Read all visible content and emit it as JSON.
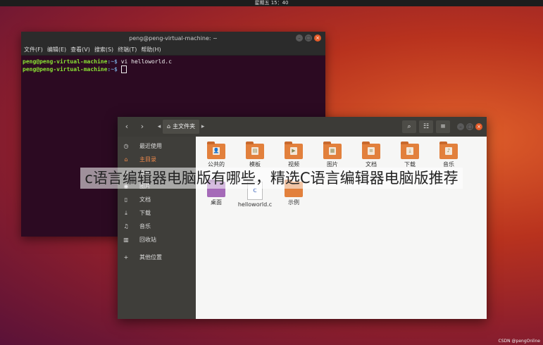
{
  "topbar": {
    "clock": "星期五 15：40"
  },
  "terminal": {
    "title": "peng@peng-virtual-machine: ~",
    "menu": [
      "文件(F)",
      "编辑(E)",
      "查看(V)",
      "搜索(S)",
      "终端(T)",
      "帮助(H)"
    ],
    "lines": [
      {
        "user": "peng@peng-virtual-machine",
        "path": ":~$",
        "cmd": " vi helloworld.c"
      },
      {
        "user": "peng@peng-virtual-machine",
        "path": ":~$",
        "cmd": " "
      }
    ]
  },
  "file_manager": {
    "location": "主文件夹",
    "sidebar": [
      {
        "icon": "clock-icon",
        "glyph": "◷",
        "label": "最近使用",
        "active": false
      },
      {
        "icon": "home-icon",
        "glyph": "⌂",
        "label": "主目录",
        "active": true
      },
      {
        "icon": "desktop-icon",
        "glyph": "▭",
        "label": "桌面",
        "active": false
      },
      {
        "icon": "camera-icon",
        "glyph": "◉",
        "label": "图片",
        "active": false
      },
      {
        "icon": "document-icon",
        "glyph": "▯",
        "label": "文档",
        "active": false
      },
      {
        "icon": "download-icon",
        "glyph": "⤓",
        "label": "下载",
        "active": false
      },
      {
        "icon": "music-icon",
        "glyph": "♫",
        "label": "音乐",
        "active": false
      },
      {
        "icon": "trash-icon",
        "glyph": "▥",
        "label": "回收站",
        "active": false
      },
      {
        "icon": "plus-icon",
        "glyph": "+",
        "label": "其他位置",
        "active": false
      }
    ],
    "files": [
      {
        "name": "公共的",
        "emb": "👤",
        "kind": "folder"
      },
      {
        "name": "模板",
        "emb": "▤",
        "kind": "folder"
      },
      {
        "name": "视频",
        "emb": "▶",
        "kind": "folder"
      },
      {
        "name": "图片",
        "emb": "▦",
        "kind": "folder"
      },
      {
        "name": "文档",
        "emb": "≡",
        "kind": "folder"
      },
      {
        "name": "下载",
        "emb": "⤓",
        "kind": "folder"
      },
      {
        "name": "音乐",
        "emb": "♪",
        "kind": "folder"
      },
      {
        "name": "桌面",
        "emb": "",
        "kind": "folder-purple"
      },
      {
        "name": "helloworld.c",
        "emb": "c",
        "kind": "doc"
      },
      {
        "name": "示例",
        "emb": "",
        "kind": "folder"
      }
    ]
  },
  "caption": "c语言编辑器电脑版有哪些，精选C语言编辑器电脑版推荐",
  "watermark": "CSDN @pengOnline"
}
